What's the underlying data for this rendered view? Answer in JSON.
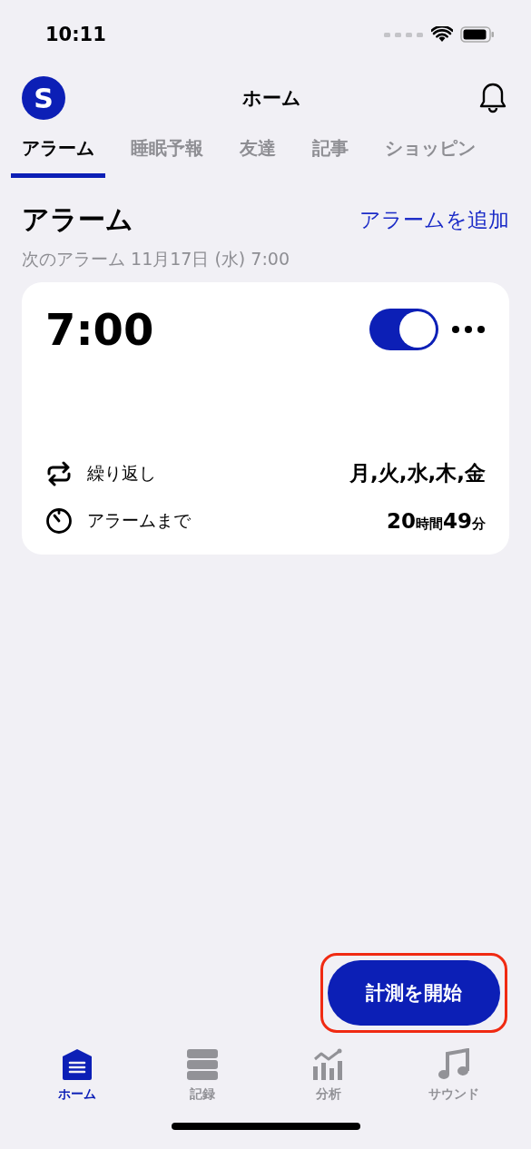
{
  "status_bar": {
    "time": "10:11"
  },
  "header": {
    "avatar_letter": "S",
    "title": "ホーム"
  },
  "tabs": [
    {
      "label": "アラーム",
      "selected": true
    },
    {
      "label": "睡眠予報",
      "selected": false
    },
    {
      "label": "友達",
      "selected": false
    },
    {
      "label": "記事",
      "selected": false
    },
    {
      "label": "ショッピン",
      "selected": false
    }
  ],
  "section": {
    "title": "アラーム",
    "action": "アラームを追加",
    "next_alarm": "次のアラーム 11月17日 (水) 7:00"
  },
  "alarm": {
    "time": "7:00",
    "on": true,
    "rows": [
      {
        "kind": "repeat",
        "label": "繰り返し",
        "value": [
          {
            "text": "月,火,水,木,金",
            "kind": "number"
          }
        ]
      },
      {
        "kind": "timer",
        "label": "アラームまで",
        "value": [
          {
            "text": "20",
            "kind": "number"
          },
          {
            "text": "時間",
            "kind": "unit"
          },
          {
            "text": "49",
            "kind": "number"
          },
          {
            "text": "分",
            "kind": "unit"
          }
        ]
      }
    ]
  },
  "start_button": {
    "label": "計測を開始",
    "highlighted": true
  },
  "tab_bar": [
    {
      "kind": "home",
      "label": "ホーム",
      "selected": true
    },
    {
      "kind": "records",
      "label": "記録",
      "selected": false
    },
    {
      "kind": "analysis",
      "label": "分析",
      "selected": false
    },
    {
      "kind": "sound",
      "label": "サウンド",
      "selected": false
    }
  ]
}
